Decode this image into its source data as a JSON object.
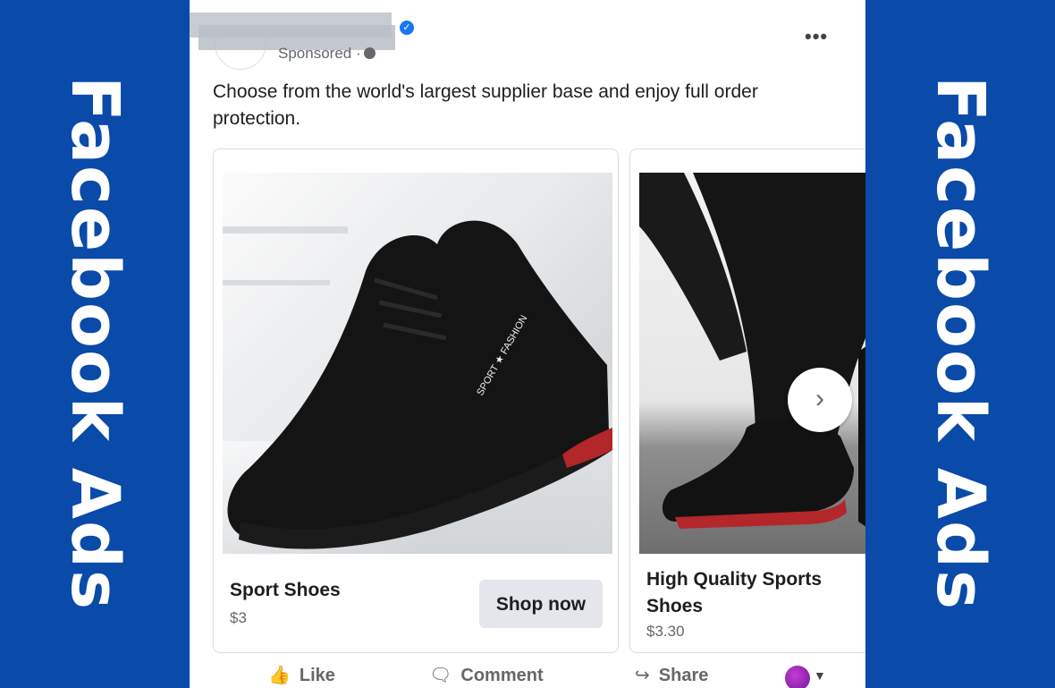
{
  "banner": {
    "label": "Facebook Ads"
  },
  "post": {
    "sponsored_label": "Sponsored ·",
    "more_icon": "more-horizontal-icon",
    "text": "Choose from the world's largest supplier base and enjoy full order protection."
  },
  "cards": [
    {
      "title": "Sport Shoes",
      "price": "$3",
      "button": "Shop now"
    },
    {
      "title": "High Quality Sports Shoes",
      "price": "$3.30"
    }
  ],
  "actions": {
    "like": "Like",
    "comment": "Comment",
    "share": "Share"
  }
}
